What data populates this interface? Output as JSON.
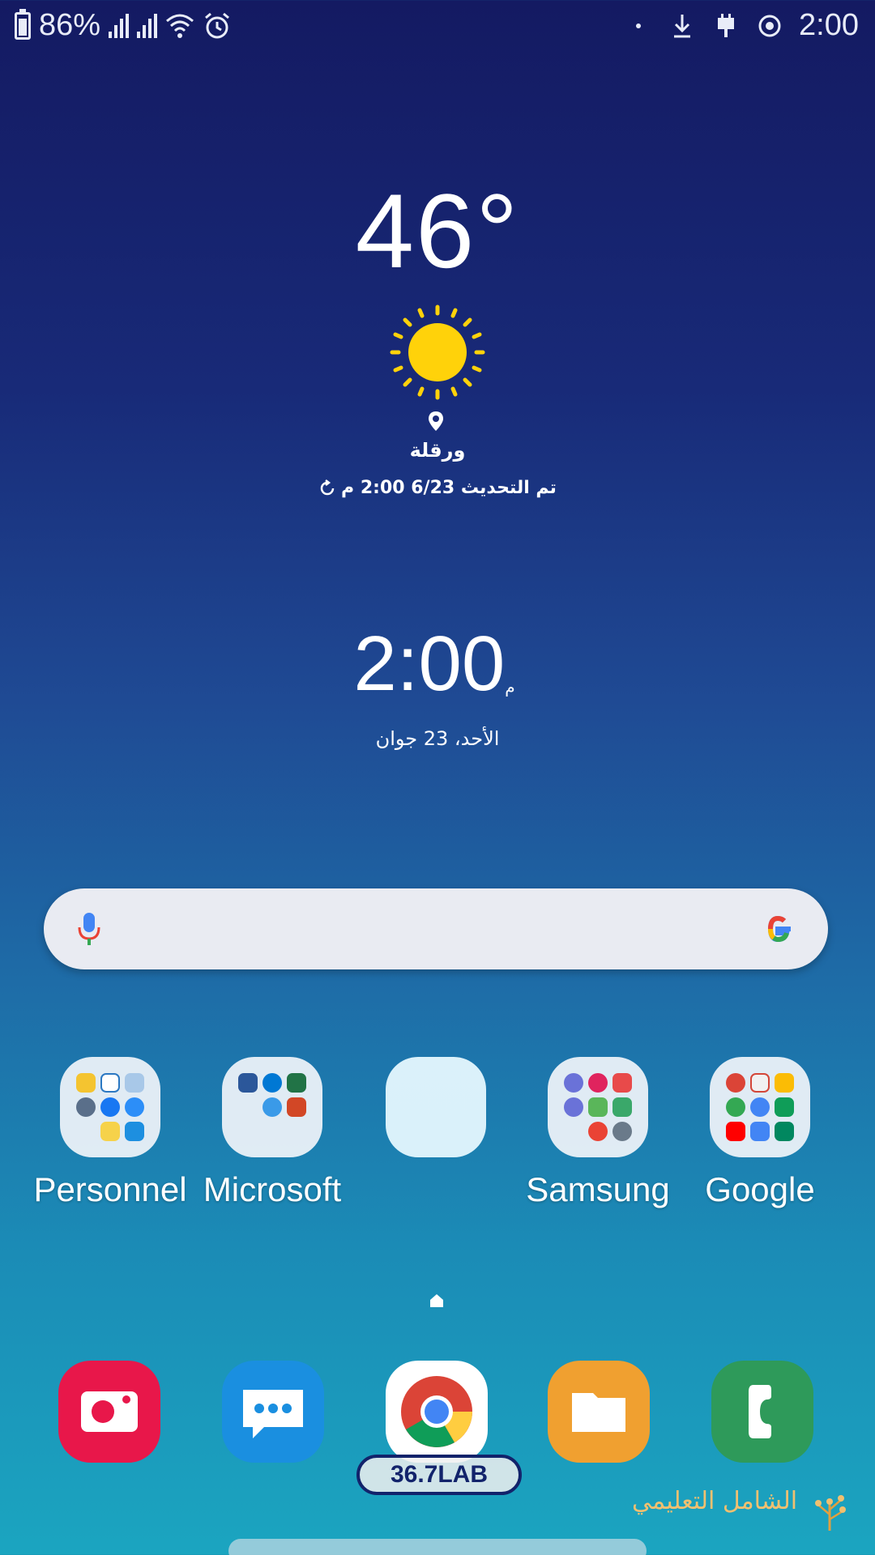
{
  "status_bar": {
    "battery_percent": "86%",
    "battery_level": 0.86,
    "time": "2:00",
    "left_icons": [
      "battery-icon",
      "signal-1-icon",
      "signal-2-icon",
      "wifi-icon",
      "alarm-icon"
    ],
    "right_icons": [
      "dot-icon",
      "download-icon",
      "usb-icon",
      "sync-icon"
    ]
  },
  "weather": {
    "temperature": "46°",
    "condition_icon": "sun-icon",
    "city": "ورقلة",
    "updated": "تم التحديث 6/23 2:00 م"
  },
  "clock": {
    "time": "2:00",
    "ampm": "م",
    "date": "الأحد، 23 جوان"
  },
  "search": {
    "mic_icon": "mic-icon",
    "google_icon": "google-g-icon"
  },
  "folders": [
    {
      "label": "Personnel"
    },
    {
      "label": "Microsoft"
    },
    {
      "label": ""
    },
    {
      "label": "Samsung"
    },
    {
      "label": "Google"
    }
  ],
  "dock": [
    {
      "icon": "camera-icon",
      "color": "#e8174a"
    },
    {
      "icon": "messages-icon",
      "color": "#1a8fe0"
    },
    {
      "icon": "chrome-icon",
      "color": "#ffffff"
    },
    {
      "icon": "files-icon",
      "color": "#f0a030"
    },
    {
      "icon": "phone-icon",
      "color": "#2e9a5a"
    }
  ],
  "watermarks": {
    "lab": "36.7LAB",
    "arabic": "الشامل التعليمي"
  }
}
